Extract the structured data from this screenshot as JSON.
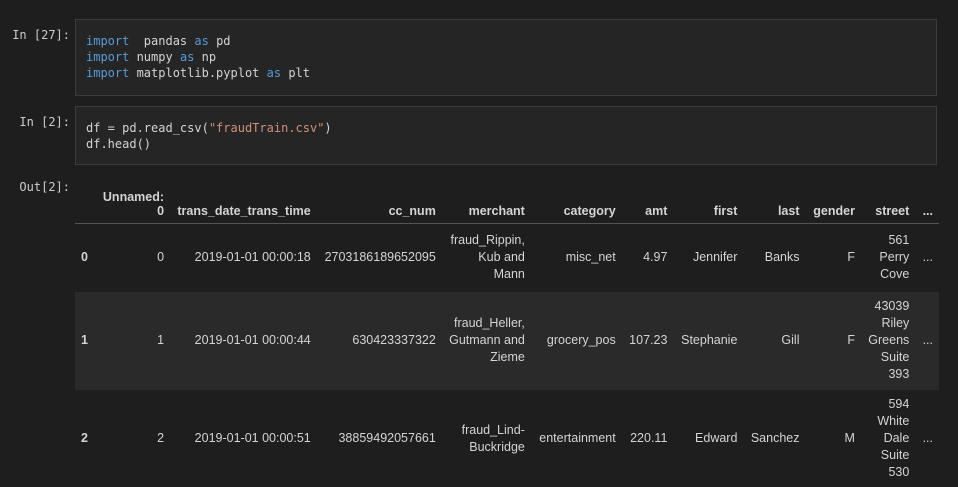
{
  "cells": [
    {
      "prompt": "In [27]:",
      "lines": [
        [
          [
            "kw",
            "import"
          ],
          [
            "",
            "  pandas "
          ],
          [
            "kw",
            "as"
          ],
          [
            "",
            " pd"
          ]
        ],
        [
          [
            "kw",
            "import"
          ],
          [
            "",
            " numpy "
          ],
          [
            "kw",
            "as"
          ],
          [
            "",
            " np"
          ]
        ],
        [
          [
            "kw",
            "import"
          ],
          [
            "",
            " matplotlib.pyplot "
          ],
          [
            "kw",
            "as"
          ],
          [
            "",
            " plt"
          ]
        ]
      ]
    },
    {
      "prompt": "In [2]:",
      "lines": [
        [
          [
            "",
            "df = pd.read_csv("
          ],
          [
            "str",
            "\"fraudTrain.csv\""
          ],
          [
            "",
            ")"
          ]
        ],
        [
          [
            "",
            "df.head()"
          ]
        ]
      ]
    }
  ],
  "output": {
    "prompt": "Out[2]:",
    "columns": [
      "",
      "Unnamed: 0",
      "trans_date_trans_time",
      "cc_num",
      "merchant",
      "category",
      "amt",
      "first",
      "last",
      "gender",
      "street",
      "..."
    ],
    "rows": [
      [
        "0",
        "0",
        "2019-01-01 00:00:18",
        "2703186189652095",
        "fraud_Rippin, Kub and Mann",
        "misc_net",
        "4.97",
        "Jennifer",
        "Banks",
        "F",
        "561 Perry Cove",
        "..."
      ],
      [
        "1",
        "1",
        "2019-01-01 00:00:44",
        "630423337322",
        "fraud_Heller, Gutmann and Zieme",
        "grocery_pos",
        "107.23",
        "Stephanie",
        "Gill",
        "F",
        "43039 Riley Greens Suite 393",
        "..."
      ],
      [
        "2",
        "2",
        "2019-01-01 00:00:51",
        "38859492057661",
        "fraud_Lind-Buckridge",
        "entertainment",
        "220.11",
        "Edward",
        "Sanchez",
        "M",
        "594 White Dale Suite 530",
        "..."
      ]
    ]
  },
  "colors": {
    "keyword": "#569cd6",
    "string": "#ce9178",
    "background": "#1e1e1e"
  }
}
